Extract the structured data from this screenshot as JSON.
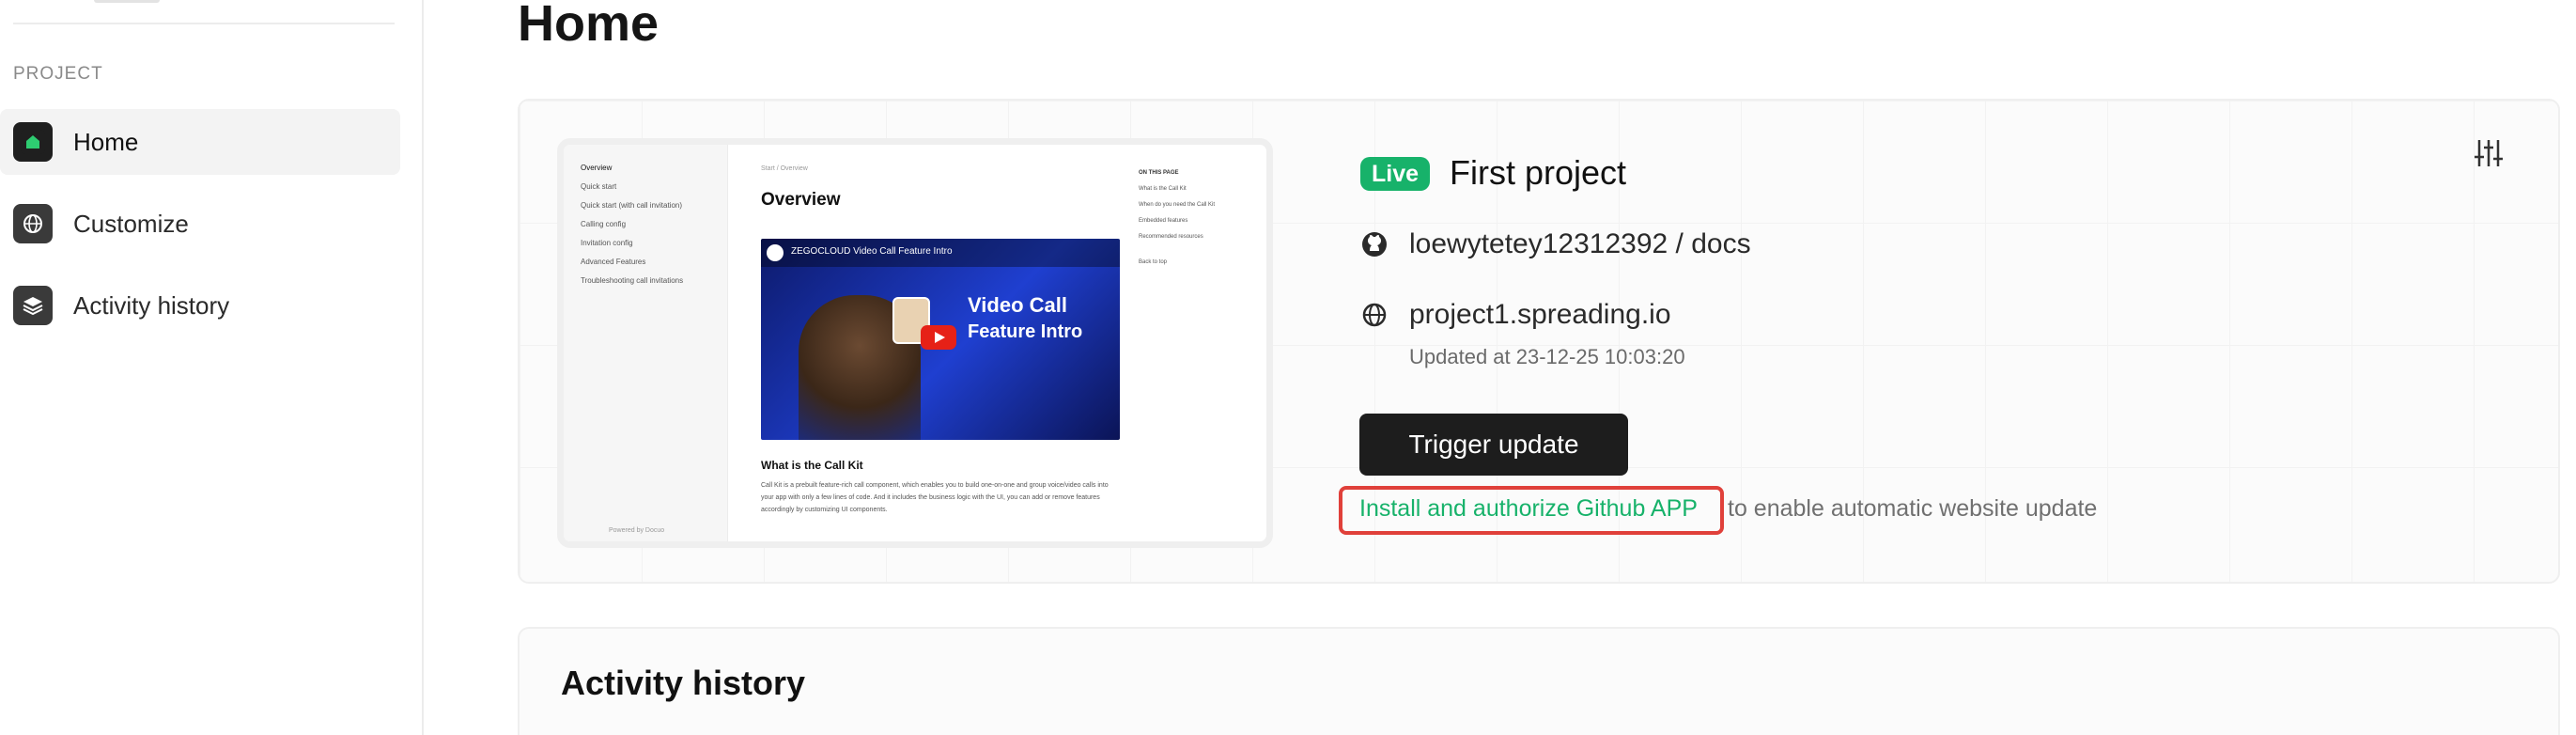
{
  "sidebar": {
    "section_label": "PROJECT",
    "items": [
      {
        "label": "Home",
        "icon": "home-icon",
        "active": true
      },
      {
        "label": "Customize",
        "icon": "globe-icon",
        "active": false
      },
      {
        "label": "Activity history",
        "icon": "layers-icon",
        "active": false
      }
    ]
  },
  "page": {
    "title": "Home"
  },
  "project": {
    "status": "Live",
    "name": "First project",
    "repo": "loewytetey12312392 / docs",
    "domain": "project1.spreading.io",
    "updated": "Updated at 23-12-25  10:03:20",
    "trigger_label": "Trigger update",
    "install_link": "Install and authorize Github APP",
    "install_rest": "to enable automatic website update"
  },
  "preview": {
    "sidebar_items": [
      "Overview",
      "Quick start",
      "Quick start (with call invitation)",
      "Calling config",
      "Invitation config",
      "Advanced Features",
      "Troubleshooting call invitations"
    ],
    "powered": "Powered by Docuo",
    "breadcrumb": "Start  /  Overview",
    "title": "Overview",
    "video_title": "ZEGOCLOUD Video Call Feature Intro",
    "video_heading1": "Video Call",
    "video_heading2": "Feature Intro",
    "section": "What is the Call Kit",
    "body": "Call Kit is a prebuilt feature-rich call component, which enables you to build one-on-one and group voice/video calls into your app with only a few lines of code. And it includes the business logic with the UI, you can add or remove features accordingly by customizing UI components.",
    "toc_title": "ON THIS PAGE",
    "toc": [
      "What is the Call Kit",
      "When do you need the Call Kit",
      "Embedded features",
      "Recommended resources",
      "Back to top"
    ]
  },
  "activity": {
    "title": "Activity history"
  },
  "colors": {
    "accent_green": "#17b26a",
    "highlight_red": "#e0403a",
    "button_dark": "#1d1d1d"
  }
}
